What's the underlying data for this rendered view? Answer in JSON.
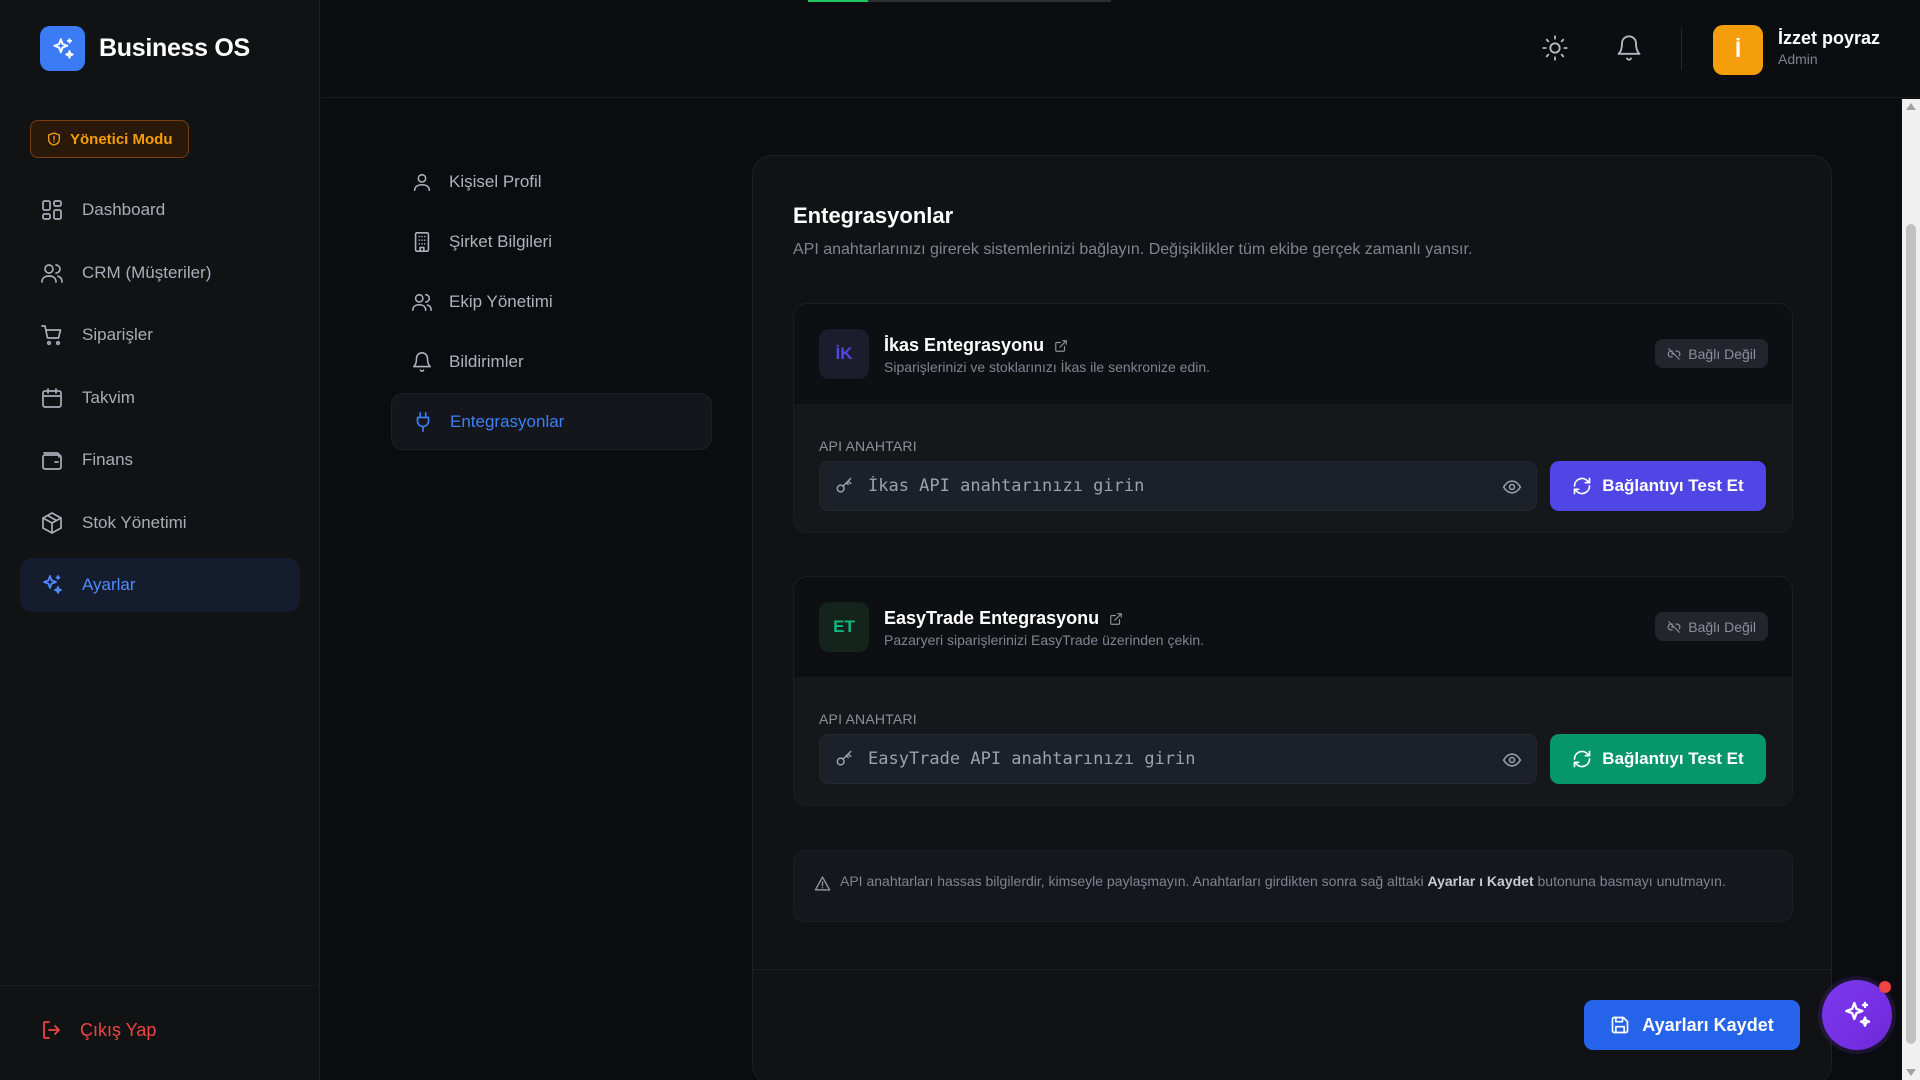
{
  "app": {
    "name": "Business OS"
  },
  "mode_badge": "Yönetici Modu",
  "nav": {
    "items": [
      {
        "label": "Dashboard",
        "icon": "dashboard-icon"
      },
      {
        "label": "CRM (Müşteriler)",
        "icon": "users-icon"
      },
      {
        "label": "Siparişler",
        "icon": "cart-icon"
      },
      {
        "label": "Takvim",
        "icon": "calendar-icon"
      },
      {
        "label": "Finans",
        "icon": "wallet-icon"
      },
      {
        "label": "Stok Yönetimi",
        "icon": "box-icon"
      },
      {
        "label": "Ayarlar",
        "icon": "sparkle-icon",
        "active": true
      }
    ],
    "logout": "Çıkış Yap"
  },
  "header": {
    "user": {
      "initial": "İ",
      "name": "İzzet poyraz",
      "role": "Admin"
    }
  },
  "settings_nav": {
    "items": [
      {
        "label": "Kişisel Profil",
        "icon": "user-icon"
      },
      {
        "label": "Şirket Bilgileri",
        "icon": "building-icon"
      },
      {
        "label": "Ekip Yönetimi",
        "icon": "team-icon"
      },
      {
        "label": "Bildirimler",
        "icon": "bell-icon"
      },
      {
        "label": "Entegrasyonlar",
        "icon": "plug-icon",
        "active": true
      }
    ]
  },
  "main": {
    "title": "Entegrasyonlar",
    "description": "API anahtarlarınızı girerek sistemlerinizi bağlayın. Değişiklikler tüm ekibe gerçek zamanlı yansır.",
    "integrations": [
      {
        "logo": "İK",
        "name": "İkas Entegrasyonu",
        "subtitle": "Siparişlerinizi ve stoklarınızı İkas ile senkronize edin.",
        "status": "Bağlı Değil",
        "api_label": "API ANAHTARI",
        "api_value": "",
        "api_placeholder": "İkas API anahtarınızı girin",
        "button": "Bağlantıyı Test Et",
        "accent": "#4f46e5"
      },
      {
        "logo": "ET",
        "name": "EasyTrade Entegrasyonu",
        "subtitle": "Pazaryeri siparişlerinizi EasyTrade üzerinden çekin.",
        "status": "Bağlı Değil",
        "api_label": "API ANAHTARI",
        "api_value": "",
        "api_placeholder": "EasyTrade API anahtarınızı girin",
        "button": "Bağlantıyı Test Et",
        "accent": "#059669"
      }
    ],
    "notice": {
      "text_before": "API anahtarları hassas bilgilerdir, kimseyle paylaşmayın. Anahtarları girdikten sonra sağ alttaki ",
      "bold": "Ayarlar ı Kaydet",
      "text_after": " butonuna basmayı unutmayın."
    },
    "save_button": "Ayarları Kaydet"
  },
  "colors": {
    "brand": "#3b7cf6",
    "active_nav": "#4d8bff",
    "warning": "#f59e0b",
    "danger": "#ef4444",
    "ikas_button": "#4f46e5",
    "easytrade_button": "#059669",
    "save_button": "#2563eb",
    "fab": "#7c3aed"
  }
}
